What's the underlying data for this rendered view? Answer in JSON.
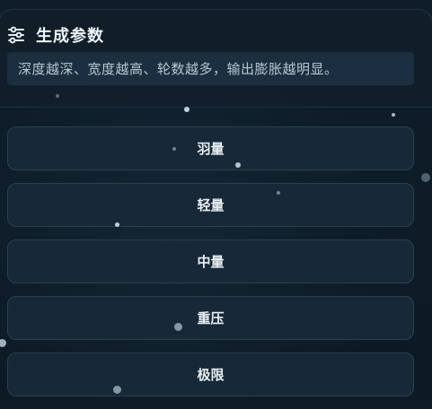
{
  "panel": {
    "title": "生成参数",
    "title_icon": "sliders-icon",
    "description": "深度越深、宽度越高、轮数越多，输出膨胀越明显。"
  },
  "options": [
    {
      "label": "羽量"
    },
    {
      "label": "轻量"
    },
    {
      "label": "中量"
    },
    {
      "label": "重压"
    },
    {
      "label": "极限"
    }
  ],
  "colors": {
    "background": "#0e1b27",
    "button_bg": "#172838",
    "button_border": "#2b4052",
    "desc_bg": "#1b2f40"
  }
}
